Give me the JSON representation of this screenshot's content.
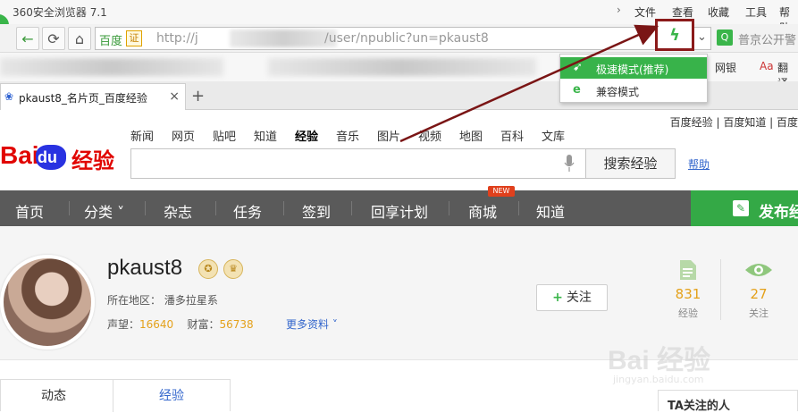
{
  "browser": {
    "title": "360安全浏览器 7.1",
    "menu": [
      "文件",
      "查看",
      "收藏",
      "工具",
      "帮助"
    ],
    "address_site": "百度",
    "address_cert": "证",
    "address_url_prefix": "http://j",
    "address_url_suffix": "/user/npublic?un=pkaust8",
    "search_placeholder": "普京公开警",
    "bookmarks": [
      "网银",
      "翻译"
    ],
    "tab_label": "pkaust8_名片页_百度经验",
    "tab_close": "×",
    "new_tab": "+",
    "speed_menu": [
      {
        "label": "极速模式(推荐)",
        "icon": "bolt-icon",
        "active": true
      },
      {
        "label": "兼容模式",
        "icon": "ie-icon",
        "active": false
      }
    ]
  },
  "page": {
    "top_links": "百度经验 | 百度知道 | 百度",
    "logo_bai": "Bai",
    "logo_du": "du",
    "logo_jy": "经验",
    "channels": [
      "新闻",
      "网页",
      "贴吧",
      "知道",
      "经验",
      "音乐",
      "图片",
      "视频",
      "地图",
      "百科",
      "文库"
    ],
    "search_button": "搜索经验",
    "help": "帮助",
    "nav": [
      "首页",
      "分类 ˅",
      "杂志",
      "任务",
      "签到",
      "回享计划",
      "商城",
      "知道"
    ],
    "new_badge": "NEW",
    "publish": "发布经验",
    "user": {
      "name": "pkaust8",
      "location_label": "所在地区：",
      "location": "潘多拉星系",
      "reputation_label": "声望：",
      "reputation": "16640",
      "wealth_label": "财富：",
      "wealth": "56738",
      "more": "更多资料 ˅",
      "follow": "关注",
      "stats": [
        {
          "num": "831",
          "label": "经验"
        },
        {
          "num": "27",
          "label": "关注"
        }
      ]
    },
    "tabs": [
      "动态",
      "经验"
    ],
    "ta_follow": "TA关注的人",
    "watermark_main": "Bai 经验",
    "watermark_url": "jingyan.baidu.com"
  },
  "colors": {
    "accent_green": "#38b34a",
    "nav_bg": "#5a5a5a",
    "highlight_box": "#8b1a1a",
    "baidu_red": "#e10602",
    "baidu_blue": "#2932e1"
  }
}
